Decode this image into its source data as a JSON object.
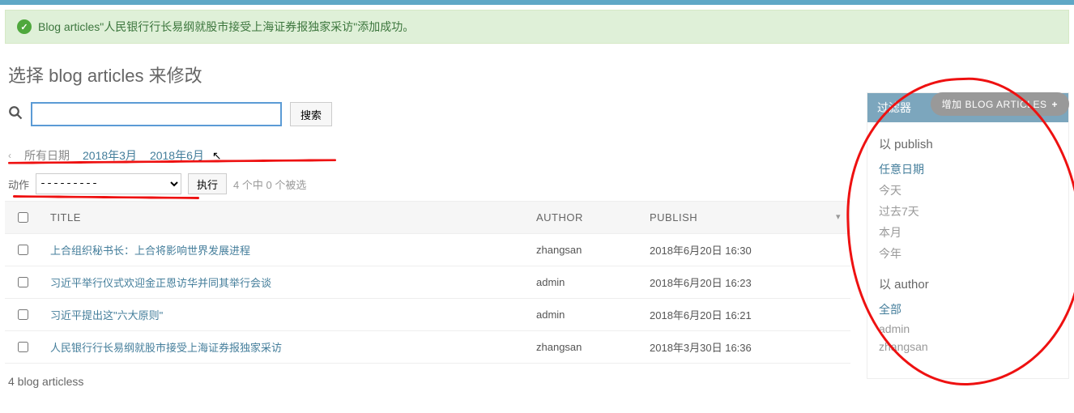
{
  "success": {
    "prefix": "Blog articles\"",
    "linked": "人民银行行长易纲就股市接受上海证券报独家采访",
    "suffix": "\"添加成功。"
  },
  "page_title": "选择 blog articles 来修改",
  "add_button": "增加 BLOG ARTICLES",
  "search": {
    "button": "搜索",
    "value": ""
  },
  "date_nav": {
    "all": "所有日期",
    "items": [
      "2018年3月",
      "2018年6月"
    ]
  },
  "actions": {
    "label": "动作",
    "placeholder": "---------",
    "go": "执行",
    "counter": "4 个中 0 个被选"
  },
  "table": {
    "headers": {
      "title": "TITLE",
      "author": "AUTHOR",
      "publish": "PUBLISH"
    },
    "rows": [
      {
        "title": "上合组织秘书长：上合将影响世界发展进程",
        "author": "zhangsan",
        "publish": "2018年6月20日 16:30"
      },
      {
        "title": "习近平举行仪式欢迎金正恩访华并同其举行会谈",
        "author": "admin",
        "publish": "2018年6月20日 16:23"
      },
      {
        "title": "习近平提出这\"六大原则\"",
        "author": "admin",
        "publish": "2018年6月20日 16:21"
      },
      {
        "title": "人民银行行长易纲就股市接受上海证券报独家采访",
        "author": "zhangsan",
        "publish": "2018年3月30日 16:36"
      }
    ],
    "paginator": "4 blog articless"
  },
  "filters": {
    "header": "过滤器",
    "publish": {
      "title": "以 publish",
      "items": [
        "任意日期",
        "今天",
        "过去7天",
        "本月",
        "今年"
      ],
      "active": 0
    },
    "author": {
      "title": "以 author",
      "items": [
        "全部",
        "admin",
        "zhangsan"
      ],
      "active": 0
    }
  }
}
